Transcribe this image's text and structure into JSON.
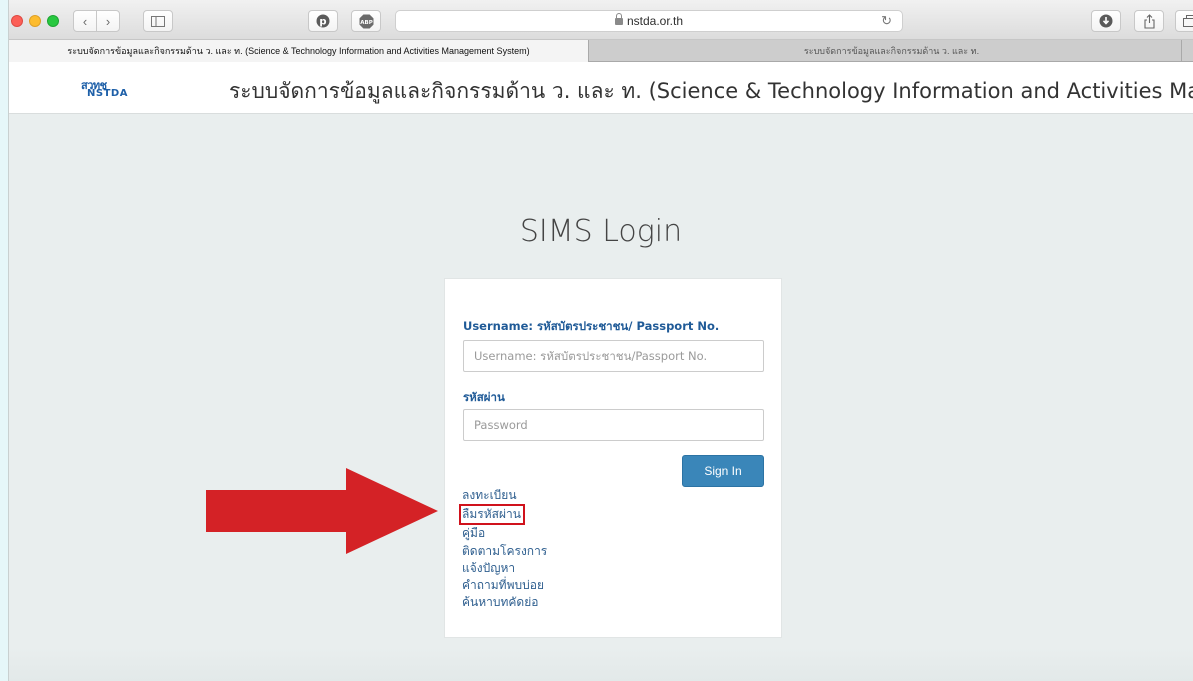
{
  "browser": {
    "url": "nstda.or.th",
    "tabs": [
      {
        "label": "ระบบจัดการข้อมูลและกิจกรรมด้าน ว. และ ท. (Science & Technology Information and Activities Management System)",
        "active": true
      },
      {
        "label": "ระบบจัดการข้อมูลและกิจกรรมด้าน ว. และ ท.",
        "active": false
      }
    ],
    "icons": {
      "back": "chevron-left-icon",
      "forward": "chevron-right-icon",
      "sidebar": "sidebar-icon",
      "pinterest": "pinterest-icon",
      "adblock": "abp-icon",
      "reload": "reload-icon",
      "download": "download-icon",
      "share": "share-icon",
      "tabs": "tabs-icon"
    },
    "abp_label": "ABP"
  },
  "header": {
    "logo_thai": "สวทช",
    "logo_en": "NSTDA",
    "title": "ระบบจัดการข้อมูลและกิจกรรมด้าน ว. และ ท. (Science & Technology Information and Activities Management Sys"
  },
  "login": {
    "heading": "SIMS Login",
    "username_label": "Username: รหัสบัตรประชาชน/ Passport No.",
    "username_placeholder": "Username: รหัสบัตรประชาชน/Passport No.",
    "password_label": "รหัสผ่าน",
    "password_placeholder": "Password",
    "signin_label": "Sign In",
    "links": [
      "ลงทะเบียน",
      "ลืมรหัสผ่าน",
      "คู่มือ",
      "ติดตามโครงการ",
      "แจ้งปัญหา",
      "คำถามที่พบบ่อย",
      "ค้นหาบทคัดย่อ"
    ]
  },
  "annotation": {
    "arrow_color": "#d42226",
    "highlight_color": "#d0121c"
  }
}
